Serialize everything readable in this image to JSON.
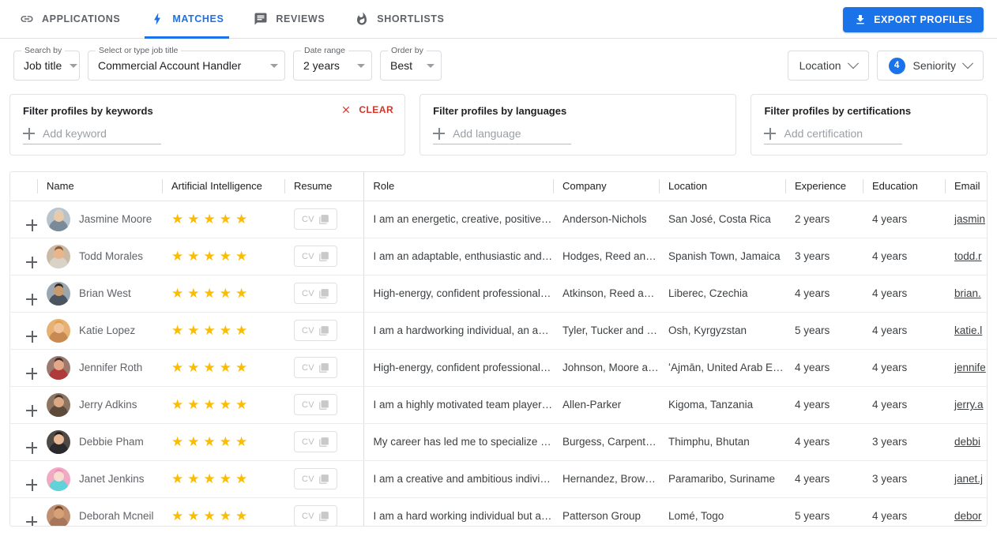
{
  "tabs": [
    {
      "label": "APPLICATIONS",
      "icon": "link-icon",
      "active": false
    },
    {
      "label": "MATCHES",
      "icon": "bolt-icon",
      "active": true
    },
    {
      "label": "REVIEWS",
      "icon": "comment-icon",
      "active": false
    },
    {
      "label": "SHORTLISTS",
      "icon": "flame-icon",
      "active": false
    }
  ],
  "export_button": {
    "label": "EXPORT PROFILES",
    "icon": "download-icon"
  },
  "filters": {
    "search_by": {
      "legend": "Search by",
      "value": "Job title"
    },
    "job_title": {
      "legend": "Select or type job title",
      "value": "Commercial Account Handler"
    },
    "date_range": {
      "legend": "Date range",
      "value": "2 years"
    },
    "order_by": {
      "legend": "Order by",
      "value": "Best"
    },
    "location_chip": {
      "label": "Location"
    },
    "seniority_chip": {
      "label": "Seniority",
      "count": "4"
    }
  },
  "filter_cards": [
    {
      "title": "Filter profiles by keywords",
      "placeholder": "Add keyword",
      "clear_label": "CLEAR",
      "has_clear": true
    },
    {
      "title": "Filter profiles by languages",
      "placeholder": "Add language",
      "has_clear": false
    },
    {
      "title": "Filter profiles by certifications",
      "placeholder": "Add certification",
      "has_clear": false
    }
  ],
  "table": {
    "columns": [
      "Name",
      "Artificial Intelligence",
      "Resume",
      "Role",
      "Company",
      "Location",
      "Experience",
      "Education",
      "Email"
    ],
    "resume_label": "CV",
    "rows": [
      {
        "name": "Jasmine Moore",
        "stars": 5,
        "role": "I am an energetic, creative, positive …",
        "company": "Anderson-Nichols",
        "location": "San José, Costa Rica",
        "experience": "2 years",
        "education": "4 years",
        "email": "jasmin",
        "skin": "#e8c9a8",
        "hair": "#cfcfcf",
        "shirt": "#7a8a99",
        "bg": "#b8c4cc"
      },
      {
        "name": "Todd Morales",
        "stars": 5,
        "role": "I am an adaptable, enthusiastic and…",
        "company": "Hodges, Reed and…",
        "location": "Spanish Town, Jamaica",
        "experience": "3 years",
        "education": "4 years",
        "email": "todd.r",
        "skin": "#e9b68c",
        "hair": "#8a5a36",
        "shirt": "#d9d2c6",
        "bg": "#cbbba6"
      },
      {
        "name": "Brian West",
        "stars": 5,
        "role": "High-energy, confident professional…",
        "company": "Atkinson, Reed an…",
        "location": "Liberec, Czechia",
        "experience": "4 years",
        "education": "4 years",
        "email": "brian.",
        "skin": "#c99a6e",
        "hair": "#2f2a26",
        "shirt": "#4a5560",
        "bg": "#9aa7b0"
      },
      {
        "name": "Katie Lopez",
        "stars": 5,
        "role": "I am a hardworking individual, an ac…",
        "company": "Tyler, Tucker and …",
        "location": "Osh, Kyrgyzstan",
        "experience": "5 years",
        "education": "4 years",
        "email": "katie.l",
        "skin": "#f0c39a",
        "hair": "#e0a24a",
        "shirt": "#c98a52",
        "bg": "#e6b173"
      },
      {
        "name": "Jennifer Roth",
        "stars": 5,
        "role": "High-energy, confident professional…",
        "company": "Johnson, Moore a…",
        "location": "ʻAjmān, United Arab Emirat",
        "experience": "4 years",
        "education": "4 years",
        "email": "jennife",
        "skin": "#e2a887",
        "hair": "#3a2f2b",
        "shirt": "#b03a3a",
        "bg": "#9b7a70"
      },
      {
        "name": "Jerry Adkins",
        "stars": 5,
        "role": "I am a highly motivated team player…",
        "company": "Allen-Parker",
        "location": "Kigoma, Tanzania",
        "experience": "4 years",
        "education": "4 years",
        "email": "jerry.a",
        "skin": "#dba884",
        "hair": "#4b3a2c",
        "shirt": "#5e4a3a",
        "bg": "#8d7563"
      },
      {
        "name": "Debbie Pham",
        "stars": 5,
        "role": "My career has led me to specialize i…",
        "company": "Burgess, Carpente…",
        "location": "Thimphu, Bhutan",
        "experience": "4 years",
        "education": "3 years",
        "email": "debbi",
        "skin": "#e7b997",
        "hair": "#241d19",
        "shirt": "#2a2a2e",
        "bg": "#4f4a46"
      },
      {
        "name": "Janet Jenkins",
        "stars": 5,
        "role": "I am a creative and ambitious indivi…",
        "company": "Hernandez, Brown…",
        "location": "Paramaribo, Suriname",
        "experience": "4 years",
        "education": "3 years",
        "email": "janet.j",
        "skin": "#f6ddd0",
        "hair": "#f090b8",
        "shirt": "#63d2d8",
        "bg": "#f2a9c4"
      },
      {
        "name": "Deborah Mcneil",
        "stars": 5,
        "role": "I am a hard working individual but a…",
        "company": "Patterson Group",
        "location": "Lomé, Togo",
        "experience": "5 years",
        "education": "4 years",
        "email": "debor",
        "skin": "#d8a077",
        "hair": "#6b4428",
        "shirt": "#a8765a",
        "bg": "#c09070"
      }
    ]
  }
}
